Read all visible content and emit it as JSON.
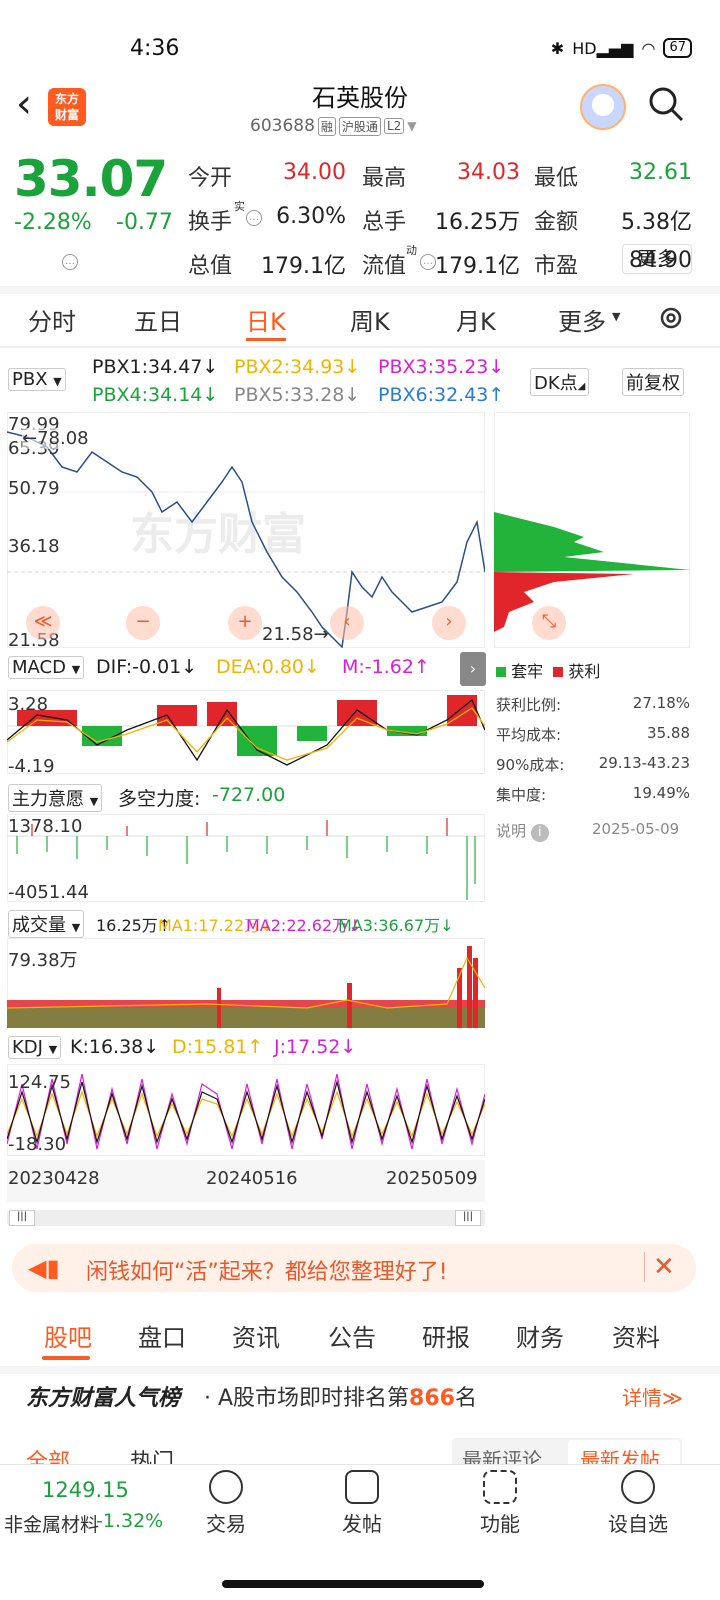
{
  "status": {
    "time": "4:36",
    "battery": "67",
    "network": "HD"
  },
  "header": {
    "stock_name": "石英股份",
    "stock_code": "603688",
    "tag_rong": "融",
    "tag_market": "沪股通",
    "tag_level": "L2",
    "logo_text": "东方财富"
  },
  "quote": {
    "price": "33.07",
    "change_pct": "-2.28%",
    "change": "-0.77",
    "rows": [
      [
        {
          "label": "今开",
          "value": "34.00",
          "color": "red"
        },
        {
          "label": "最高",
          "value": "34.03",
          "color": "red"
        },
        {
          "label": "最低",
          "value": "32.61",
          "color": "green"
        }
      ],
      [
        {
          "label": "换手",
          "value": "6.30%",
          "color": "black"
        },
        {
          "label": "总手",
          "value": "16.25万",
          "color": "black"
        },
        {
          "label": "金额",
          "value": "5.38亿",
          "color": "black"
        }
      ],
      [
        {
          "label": "总值",
          "value": "179.1亿",
          "color": "black"
        },
        {
          "label": "流值",
          "value": "179.1亿",
          "color": "black"
        },
        {
          "label": "市盈",
          "value": "84.90",
          "color": "black"
        }
      ]
    ],
    "more_label": "更多",
    "sup_shi": "实",
    "sup_dong": "动"
  },
  "period_tabs": [
    "分时",
    "五日",
    "日K",
    "周K",
    "月K",
    "更多"
  ],
  "active_period": "日K",
  "pbx": {
    "selector": "PBX",
    "items": [
      {
        "label": "PBX1:34.47↓",
        "color": "#222222"
      },
      {
        "label": "PBX2:34.93↓",
        "color": "#f0b400"
      },
      {
        "label": "PBX3:35.23↓",
        "color": "#d81ed8"
      },
      {
        "label": "PBX4:34.14↓",
        "color": "#1aa33a"
      },
      {
        "label": "PBX5:33.28↓",
        "color": "#888888"
      },
      {
        "label": "PBX6:32.43↑",
        "color": "#2a7bd4"
      }
    ],
    "dk_label": "DK点",
    "adj_label": "前复权"
  },
  "kline": {
    "y_top": "79.99",
    "y_top2": "65.39",
    "y_mid": "50.79",
    "y_low": "36.18",
    "y_bottom": "21.58",
    "max_label": "78.08",
    "min_label": "21.58",
    "watermark": "东方财富"
  },
  "chip": {
    "legend_trapped": "套牢",
    "legend_profit": "获利",
    "stats": [
      {
        "label": "获利比例:",
        "value": "27.18%"
      },
      {
        "label": "平均成本:",
        "value": "35.88"
      },
      {
        "label": "90%成本:",
        "value": "29.13-43.23"
      },
      {
        "label": "集中度:",
        "value": "19.49%"
      }
    ],
    "note_label": "说明",
    "date": "2025-05-09"
  },
  "macd": {
    "selector": "MACD",
    "dif": "DIF:-0.01↓",
    "dea": "DEA:0.80↓",
    "m": "M:-1.62↑",
    "y_top": "3.28",
    "y_bottom": "-4.19"
  },
  "main_force": {
    "selector": "主力意愿",
    "label": "多空力度:",
    "value": "-727.00",
    "y_top": "1378.10",
    "y_bottom": "-4051.44"
  },
  "volume": {
    "selector": "成交量",
    "vol": "16.25万↑",
    "ma1": "MA1:17.22万↓",
    "ma2": "MA2:22.62万↓",
    "ma3": "MA3:36.67万↓",
    "y_top": "79.38万"
  },
  "kdj": {
    "selector": "KDJ",
    "k": "K:16.38↓",
    "d": "D:15.81↑",
    "j": "J:17.52↓",
    "y_top": "124.75",
    "y_bottom": "-18.30"
  },
  "dates": [
    "20230428",
    "20240516",
    "20250509"
  ],
  "ad": {
    "text": "闲钱如何“活”起来？都给您整理好了!"
  },
  "content_tabs": [
    "股吧",
    "盘口",
    "资讯",
    "公告",
    "研报",
    "财务",
    "资料"
  ],
  "rank": {
    "brand": "东方财富人气榜",
    "text_pre": "· A股市场即时排名第",
    "rank_num": "866",
    "text_post": "名",
    "detail": "详情≫"
  },
  "sub_tabs": {
    "all": "全部",
    "hot": "热门",
    "latest_comment": "最新评论",
    "latest_post": "最新发帖"
  },
  "bottom": {
    "index_value": "1249.15",
    "index_name": "非金属材料",
    "index_change": "-1.32%",
    "nav": [
      "交易",
      "发帖",
      "功能",
      "设自选"
    ]
  }
}
